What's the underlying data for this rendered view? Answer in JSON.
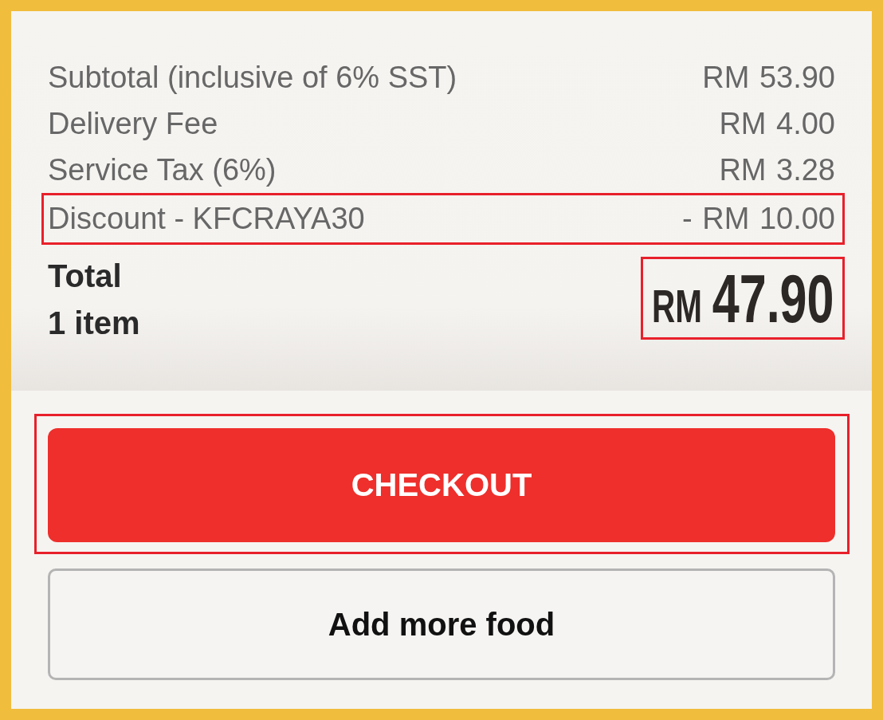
{
  "summary_rows": [
    {
      "label": "Subtotal (inclusive of 6% SST)",
      "amount": "RM 53.90",
      "highlighted": false
    },
    {
      "label": "Delivery Fee",
      "amount": "RM 4.00",
      "highlighted": false
    },
    {
      "label": "Service Tax (6%)",
      "amount": "RM 3.28",
      "highlighted": false
    },
    {
      "label": "Discount - KFCRAYA30",
      "amount": "- RM 10.00",
      "highlighted": true
    }
  ],
  "total": {
    "label": "Total",
    "item_count": "1 item",
    "currency": "RM",
    "amount": "47.90",
    "highlighted": true
  },
  "buttons": [
    {
      "label": "CHECKOUT",
      "kind": "primary",
      "highlighted": true
    },
    {
      "label": "Add more food",
      "kind": "secondary",
      "highlighted": false
    }
  ]
}
